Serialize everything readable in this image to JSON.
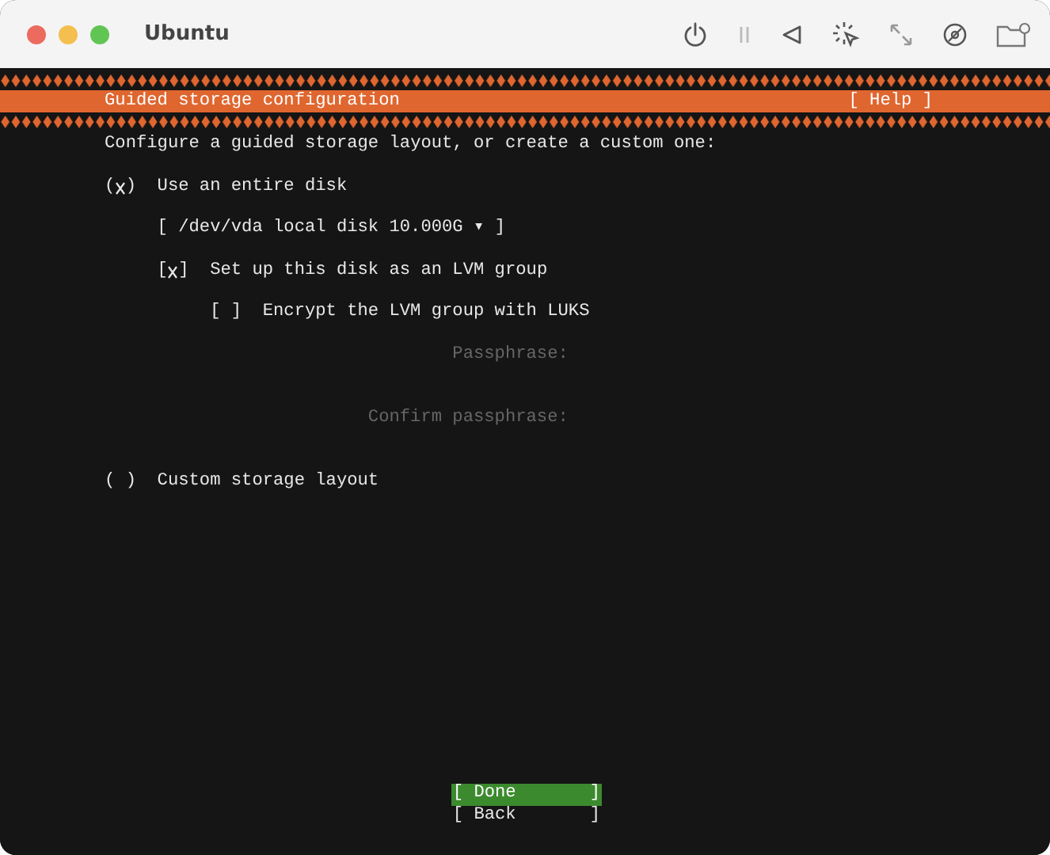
{
  "window": {
    "title": "Ubuntu"
  },
  "header": {
    "title": "Guided storage configuration",
    "help": "[ Help ]"
  },
  "intro": "Configure a guided storage layout, or create a custom one:",
  "options": [
    {
      "kind": "radio",
      "marker": "( )",
      "selected": true,
      "label": "Use an entire disk",
      "children": [
        {
          "kind": "dropdown",
          "label": "[ /dev/vda local disk 10.000G ▾ ]"
        },
        {
          "kind": "checkbox",
          "marker": "[ ]",
          "checked": true,
          "label": "Set up this disk as an LVM group",
          "children": [
            {
              "kind": "checkbox",
              "marker": "[ ]",
              "checked": false,
              "label": "Encrypt the LVM group with LUKS"
            },
            {
              "kind": "field",
              "label": "Passphrase:",
              "disabled": true
            },
            {
              "kind": "field",
              "label": "Confirm passphrase:",
              "disabled": true
            }
          ]
        }
      ]
    },
    {
      "kind": "radio",
      "marker": "( )",
      "selected": false,
      "label": "Custom storage layout"
    }
  ],
  "buttons": [
    {
      "label": "[ Done       ]",
      "selected": true
    },
    {
      "label": "[ Back       ]",
      "selected": false
    }
  ]
}
